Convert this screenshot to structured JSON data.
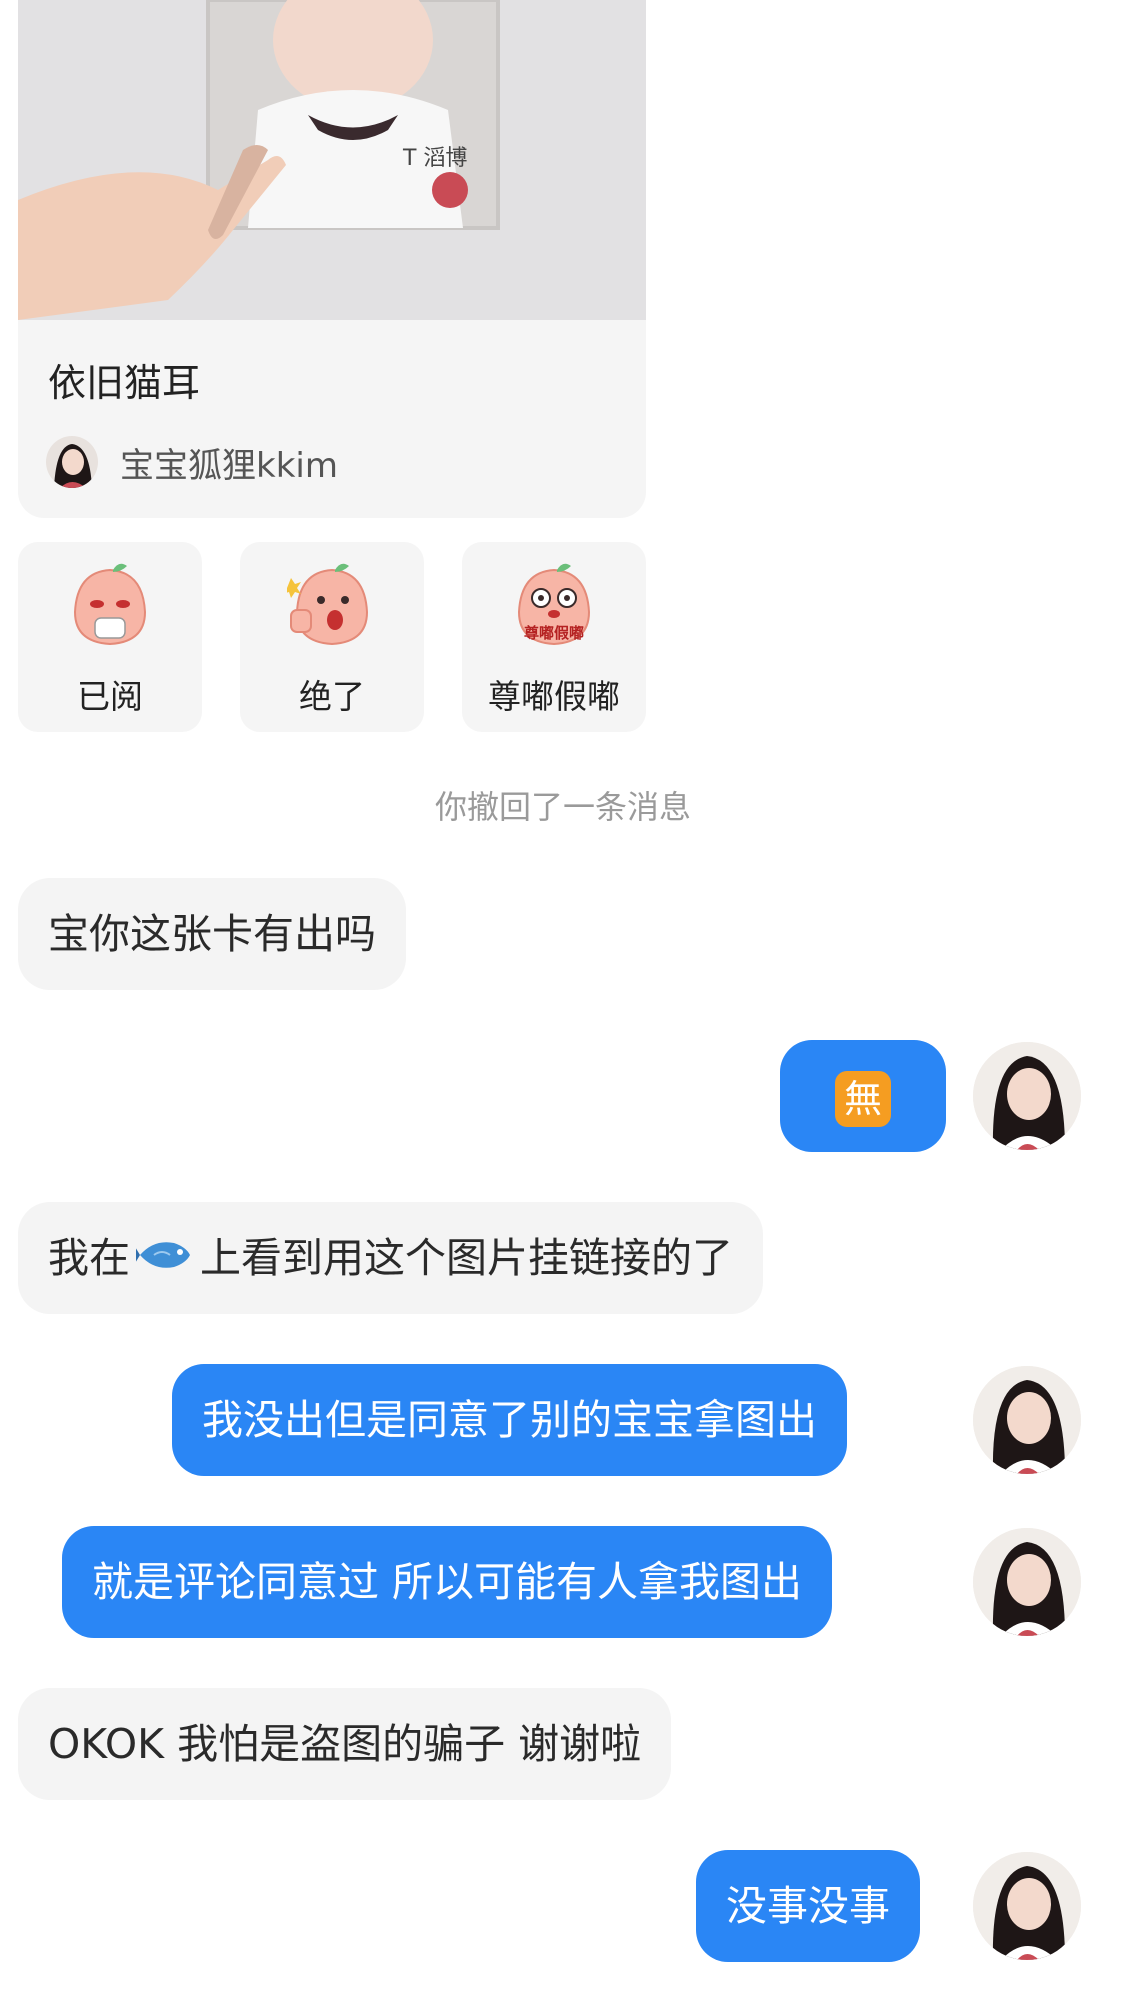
{
  "shared_card": {
    "title": "依旧猫耳",
    "author": "宝宝狐狸kkim"
  },
  "stickers": [
    {
      "label": "已阅",
      "icon": "peach-sticker-tea-icon"
    },
    {
      "label": "绝了",
      "icon": "peach-sticker-thumbs-up-icon"
    },
    {
      "label": "尊嘟假嘟",
      "icon": "peach-sticker-surprised-icon",
      "overlay_text": "尊嘟假嘟"
    }
  ],
  "system_notice": "你撤回了一条消息",
  "messages": [
    {
      "side": "in",
      "text": "宝你这张卡有出吗"
    },
    {
      "side": "out",
      "text": "🈚",
      "emoji": "no-emoji-square"
    },
    {
      "side": "in",
      "text_before": "我在",
      "icon": "fish-icon",
      "text_after": "上看到用这个图片挂链接的了"
    },
    {
      "side": "out",
      "text": "我没出但是同意了别的宝宝拿图出"
    },
    {
      "side": "out",
      "text": "就是评论同意过 所以可能有人拿我图出"
    },
    {
      "side": "in",
      "text": "OKOK 我怕是盗图的骗子 谢谢啦"
    },
    {
      "side": "out",
      "text": "没事没事"
    }
  ],
  "colors": {
    "outgoing_bubble": "#2a86f5",
    "incoming_bubble": "#f4f4f4",
    "background": "#ffffff"
  }
}
